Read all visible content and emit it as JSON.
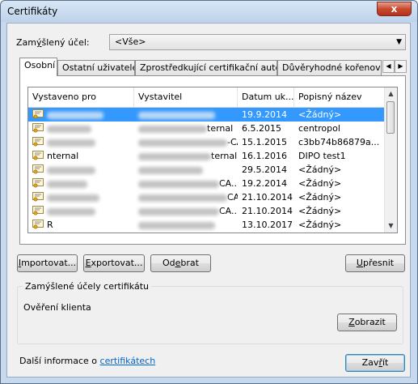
{
  "window": {
    "title": "Certifikáty",
    "close_label": "x"
  },
  "purpose": {
    "label": "Zamýšlený účel:",
    "selected": "<Vše>"
  },
  "tabs": [
    {
      "label": "Osobní",
      "active": true
    },
    {
      "label": "Ostatní uživatelé"
    },
    {
      "label": "Zprostředkující certifikační autority"
    },
    {
      "label": "Důvěryhodné kořenové ce"
    }
  ],
  "columns": [
    "Vystaveno pro",
    "Vystavitel",
    "Datum uk...",
    "Popisný název"
  ],
  "rows": [
    {
      "issued_to": "",
      "issuer": "",
      "date": "19.9.2014",
      "friendly": "<Žádný>",
      "selected": true
    },
    {
      "issued_to": "",
      "issuer": "ternal",
      "date": "6.5.2015",
      "friendly": "centropol"
    },
    {
      "issued_to": "",
      "issuer": "-CA...",
      "date": "15.1.2015",
      "friendly": "c3bb74b86879a..."
    },
    {
      "issued_to": "nternal",
      "issuer": "ternal",
      "date": "16.1.2016",
      "friendly": "DIPO test1"
    },
    {
      "issued_to": "",
      "issuer": "",
      "date": "29.5.2014",
      "friendly": "<Žádný>"
    },
    {
      "issued_to": "",
      "issuer": "CA...",
      "date": "19.2.2014",
      "friendly": "<Žádný>"
    },
    {
      "issued_to": "",
      "issuer": "CA...",
      "date": "21.10.2014",
      "friendly": "<Žádný>"
    },
    {
      "issued_to": "",
      "issuer": "CA...",
      "date": "21.10.2014",
      "friendly": "<Žádný>"
    },
    {
      "issued_to": "R",
      "issuer": "",
      "date": "13.10.2017",
      "friendly": "<Žádný>"
    }
  ],
  "buttons": {
    "import": "Importovat...",
    "export": "Exportovat...",
    "remove": "Odebrat",
    "advanced": "Upřesnit",
    "view": "Zobrazit",
    "close": "Zavřít"
  },
  "group": {
    "title": "Zamýšlené účely certifikátu",
    "text": "Ověření klienta"
  },
  "footer": {
    "text": "Další informace o ",
    "link": "certifikátech"
  },
  "colors": {
    "selection": "#3399ff",
    "link": "#0066cc",
    "frame": "#c6d9ee",
    "close": "#c84a2f"
  }
}
